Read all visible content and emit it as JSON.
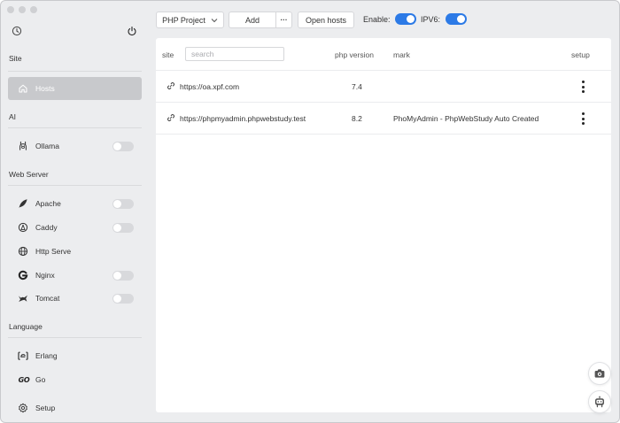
{
  "sidebar": {
    "sections": {
      "site": "Site",
      "ai": "AI",
      "web_server": "Web Server",
      "language": "Language"
    },
    "items": {
      "hosts": "Hosts",
      "ollama": "Ollama",
      "apache": "Apache",
      "caddy": "Caddy",
      "http_serve": "Http Serve",
      "nginx": "Nginx",
      "tomcat": "Tomcat",
      "erlang": "Erlang",
      "go": "Go",
      "setup": "Setup"
    },
    "go_logo_text": "GO"
  },
  "toolbar": {
    "project_select": "PHP Project",
    "add_label": "Add",
    "more_label": "···",
    "open_hosts_label": "Open hosts",
    "enable_label": "Enable:",
    "ipv6_label": "IPV6:"
  },
  "table": {
    "headers": {
      "site": "site",
      "php_version": "php version",
      "mark": "mark",
      "setup": "setup"
    },
    "search_placeholder": "search",
    "rows": [
      {
        "site": "https://oa.xpf.com",
        "php_version": "7.4",
        "mark": ""
      },
      {
        "site": "https://phpmyadmin.phpwebstudy.test",
        "php_version": "8.2",
        "mark": "PhoMyAdmin - PhpWebStudy Auto Created"
      }
    ]
  },
  "colors": {
    "accent": "#2c7ae6",
    "active_item": "#c8c9cc",
    "sidebar_bg": "#ecedef"
  }
}
